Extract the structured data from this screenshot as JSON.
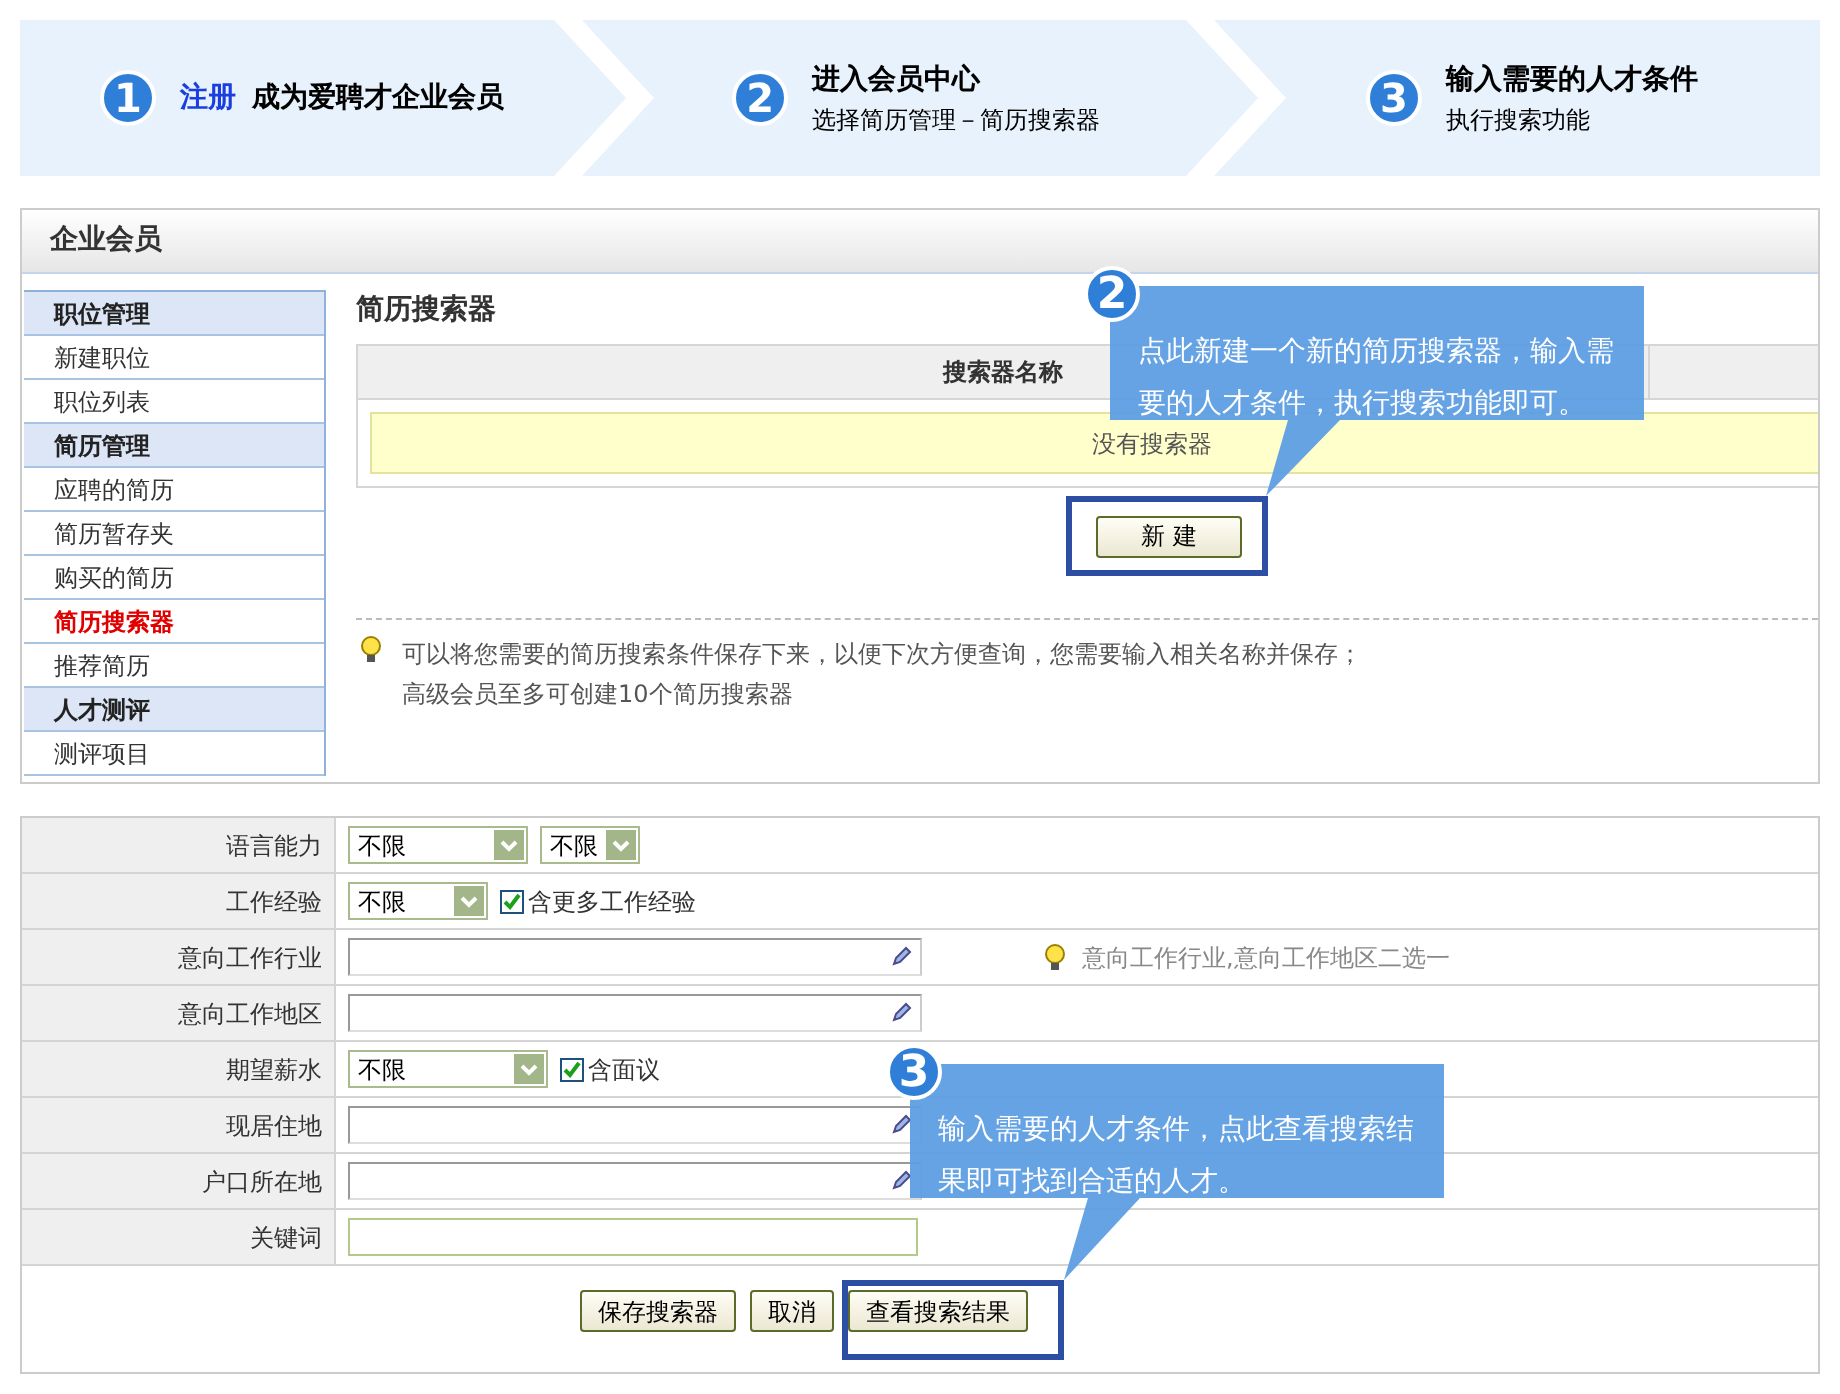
{
  "steps": [
    {
      "number": "1",
      "link": "注册",
      "title": "成为爱聘才企业会员"
    },
    {
      "number": "2",
      "title": "进入会员中心",
      "subtitle": "选择简历管理－简历搜索器"
    },
    {
      "number": "3",
      "title": "输入需要的人才条件",
      "subtitle": "执行搜索功能"
    }
  ],
  "panel_title": "企业会员",
  "sidebar": [
    {
      "kind": "header",
      "label": "职位管理"
    },
    {
      "kind": "item",
      "label": "新建职位",
      "selected": false
    },
    {
      "kind": "item",
      "label": "职位列表",
      "selected": false
    },
    {
      "kind": "header",
      "label": "简历管理"
    },
    {
      "kind": "item",
      "label": "应聘的简历",
      "selected": false
    },
    {
      "kind": "item",
      "label": "简历暂存夹",
      "selected": false
    },
    {
      "kind": "item",
      "label": "购买的简历",
      "selected": false
    },
    {
      "kind": "item",
      "label": "简历搜索器",
      "selected": true
    },
    {
      "kind": "item",
      "label": "推荐简历",
      "selected": false
    },
    {
      "kind": "header",
      "label": "人才测评"
    },
    {
      "kind": "item",
      "label": "测评项目",
      "selected": false
    }
  ],
  "content": {
    "title": "简历搜索器",
    "table": {
      "columns": [
        "搜索器名称"
      ],
      "empty_text": "没有搜索器"
    },
    "new_button": "新 建",
    "tips": [
      "可以将您需要的简历搜索条件保存下来，以便下次方便查询，您需要输入相关名称并保存；",
      "高级会员至多可创建10个简历搜索器"
    ]
  },
  "form": {
    "rows": [
      {
        "label": "语言能力",
        "controls": [
          {
            "kind": "select-medium",
            "value": "不限"
          },
          {
            "kind": "select-mini",
            "value": "不限"
          }
        ]
      },
      {
        "label": "工作经验",
        "controls": [
          {
            "kind": "select-short",
            "value": "不限"
          },
          {
            "kind": "checkbox",
            "label": "含更多工作经验",
            "checked": true
          }
        ]
      },
      {
        "label": "意向工作行业",
        "controls": [
          {
            "kind": "picker"
          },
          {
            "kind": "hint",
            "text": "意向工作行业,意向工作地区二选一"
          }
        ]
      },
      {
        "label": "意向工作地区",
        "controls": [
          {
            "kind": "picker"
          }
        ]
      },
      {
        "label": "期望薪水",
        "controls": [
          {
            "kind": "select-long",
            "value": "不限"
          },
          {
            "kind": "checkbox",
            "label": "含面议",
            "checked": true
          }
        ]
      },
      {
        "label": "现居住地",
        "controls": [
          {
            "kind": "picker"
          }
        ]
      },
      {
        "label": "户口所在地",
        "controls": [
          {
            "kind": "picker"
          }
        ]
      },
      {
        "label": "关键词",
        "controls": [
          {
            "kind": "text"
          }
        ]
      }
    ],
    "buttons": [
      "保存搜索器",
      "取消",
      "查看搜索结果"
    ]
  },
  "callouts": [
    {
      "number": "2",
      "text": "点此新建一个新的简历搜索器，输入需要的人才条件，执行搜索功能即可。"
    },
    {
      "number": "3",
      "text": "输入需要的人才条件，点此查看搜索结果即可找到合适的人才。"
    }
  ]
}
